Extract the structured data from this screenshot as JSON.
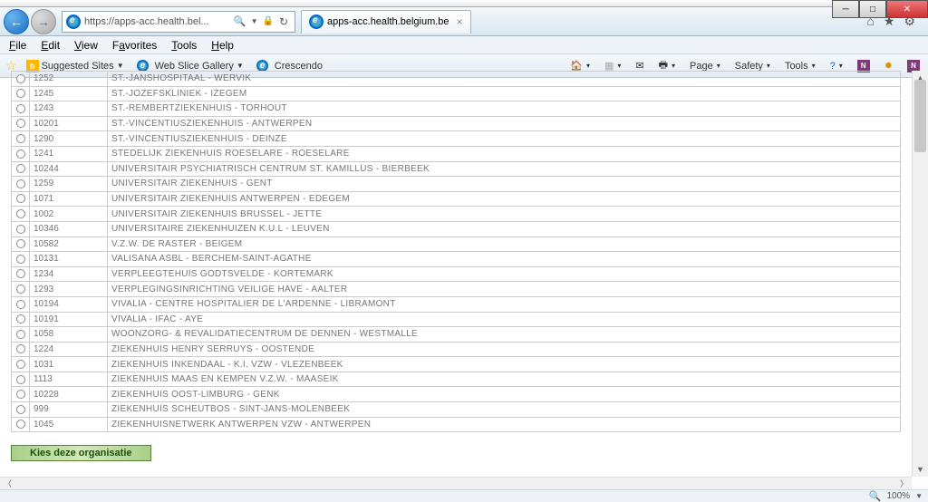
{
  "window": {
    "url_display": "https://apps-acc.health.bel...",
    "tab_title": "apps-acc.health.belgium.be"
  },
  "menus": {
    "file": "File",
    "edit": "Edit",
    "view": "View",
    "favorites": "Favorites",
    "tools": "Tools",
    "help": "Help"
  },
  "favbar": {
    "suggested": "Suggested Sites",
    "webslice": "Web Slice Gallery",
    "crescendo": "Crescendo",
    "page": "Page",
    "safety": "Safety",
    "tools": "Tools"
  },
  "rows": [
    {
      "id": "1252",
      "name": "ST.-JANSHOSPITAAL - WERVIK"
    },
    {
      "id": "1245",
      "name": "ST.-JOZEFSKLINIEK - IZEGEM"
    },
    {
      "id": "1243",
      "name": "ST.-REMBERTZIEKENHUIS - TORHOUT"
    },
    {
      "id": "10201",
      "name": "ST.-VINCENTIUSZIEKENHUIS - ANTWERPEN"
    },
    {
      "id": "1290",
      "name": "ST.-VINCENTIUSZIEKENHUIS - DEINZE"
    },
    {
      "id": "1241",
      "name": "STEDELIJK ZIEKENHUIS ROESELARE - ROESELARE"
    },
    {
      "id": "10244",
      "name": "UNIVERSITAIR PSYCHIATRISCH CENTRUM ST. KAMILLUS - BIERBEEK"
    },
    {
      "id": "1259",
      "name": "UNIVERSITAIR ZIEKENHUIS - GENT"
    },
    {
      "id": "1071",
      "name": "UNIVERSITAIR ZIEKENHUIS ANTWERPEN - EDEGEM"
    },
    {
      "id": "1002",
      "name": "UNIVERSITAIR ZIEKENHUIS BRUSSEL - JETTE"
    },
    {
      "id": "10346",
      "name": "UNIVERSITAIRE ZIEKENHUIZEN K.U.L - LEUVEN"
    },
    {
      "id": "10582",
      "name": "V.Z.W. DE RASTER - BEIGEM"
    },
    {
      "id": "10131",
      "name": "VALISANA ASBL - BERCHEM-SAINT-AGATHE"
    },
    {
      "id": "1234",
      "name": "VERPLEEGTEHUIS GODTSVELDE - KORTEMARK"
    },
    {
      "id": "1293",
      "name": "VERPLEGINGSINRICHTING VEILIGE HAVE - AALTER"
    },
    {
      "id": "10194",
      "name": "VIVALIA - CENTRE HOSPITALIER DE L'ARDENNE - LIBRAMONT"
    },
    {
      "id": "10191",
      "name": "VIVALIA - IFAC - AYE"
    },
    {
      "id": "1058",
      "name": "WOONZORG- & REVALIDATIECENTRUM DE DENNEN - WESTMALLE"
    },
    {
      "id": "1224",
      "name": "ZIEKENHUIS HENRY SERRUYS - OOSTENDE"
    },
    {
      "id": "1031",
      "name": "ZIEKENHUIS INKENDAAL - K.I. VZW - VLEZENBEEK"
    },
    {
      "id": "1113",
      "name": "ZIEKENHUIS MAAS EN KEMPEN V.Z.W. - MAASEIK"
    },
    {
      "id": "10228",
      "name": "ZIEKENHUIS OOST-LIMBURG - GENK"
    },
    {
      "id": "999",
      "name": "ZIEKENHUIS SCHEUTBOS - SINT-JANS-MOLENBEEK"
    },
    {
      "id": "1045",
      "name": "ZIEKENHUISNETWERK ANTWERPEN VZW - ANTWERPEN"
    }
  ],
  "action_button": "Kies deze organisatie",
  "status": {
    "zoom": "100%"
  }
}
